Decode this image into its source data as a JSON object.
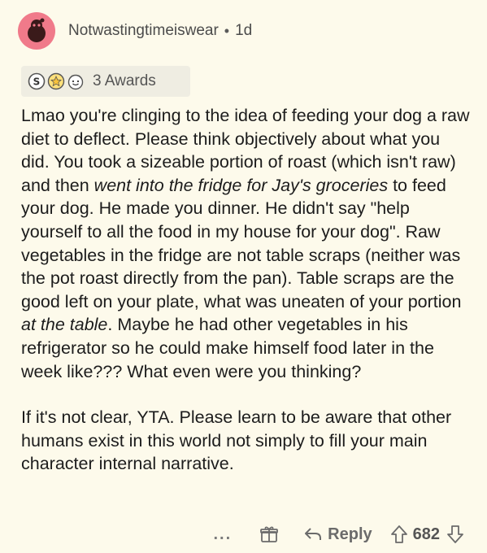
{
  "comment": {
    "author": "Notwastingtimeiswear",
    "separator": "•",
    "age": "1d",
    "awards_label": "3 Awards",
    "paragraph1": {
      "seg1": "Lmao you're clinging to the idea of feeding your dog a raw diet to deflect. Please think objectively about what you did. You took a sizeable portion of roast (which isn't raw) and then ",
      "em1": "went into the fridge for Jay's groceries",
      "seg2": " to feed your dog. He made you dinner. He didn't say \"help yourself to all the food in my house for your dog\". Raw vegetables in the fridge are not table scraps (neither was the pot roast directly from the pan). Table scraps are the good left on your plate, what was uneaten of your portion ",
      "em2": "at the table",
      "seg3": ". Maybe he had other vegetables in his refrigerator so he could make himself food later in the week like??? What even were you thinking?"
    },
    "paragraph2": "If it's not clear, YTA. Please learn to be aware that other humans exist in this world not simply to fill your main character internal narrative.",
    "footer": {
      "more": "...",
      "reply_label": "Reply",
      "score": "682"
    }
  },
  "colors": {
    "background": "#fdfaeb",
    "avatar": "#f07a8a",
    "awards_bg": "#efede2",
    "text": "#1c1c1c",
    "muted": "#6b6b6b"
  },
  "icons": [
    "reddit-avatar-icon",
    "silver-award-icon",
    "helpful-award-icon",
    "wholesome-award-icon",
    "gift-icon",
    "reply-arrow-icon",
    "upvote-icon",
    "downvote-icon"
  ]
}
